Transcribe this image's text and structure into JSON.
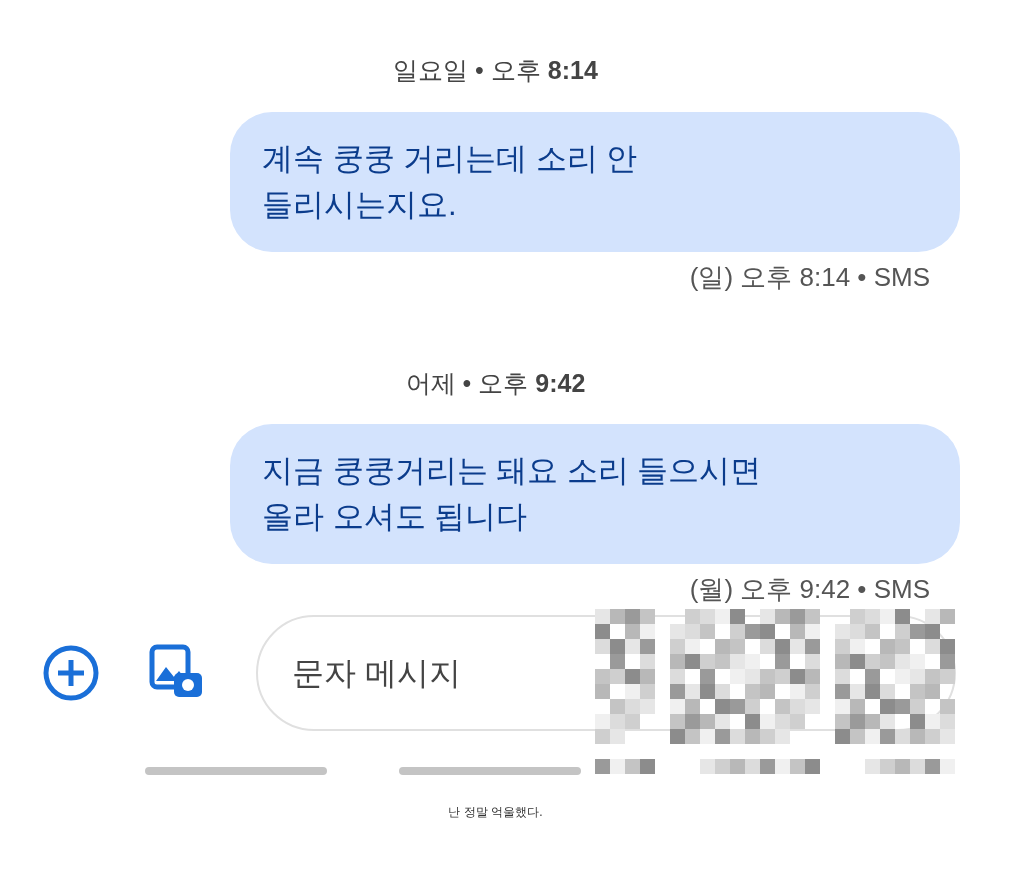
{
  "messages": [
    {
      "date_header": "일요일 • 오후 **8:14**",
      "text": "계속 쿵쿵 거리는데 소리 안\n들리시는지요.",
      "meta": "(일) 오후 8:14 • SMS"
    },
    {
      "date_header": "어제 • 오후 **9:42**",
      "text": "지금 쿵쿵거리는 돼요 소리 들으시면\n올라 오셔도 됩니다",
      "meta": "(월) 오후 9:42 • SMS"
    }
  ],
  "composer": {
    "placeholder": "문자 메시지"
  },
  "caption": "난 정말 억울했다."
}
